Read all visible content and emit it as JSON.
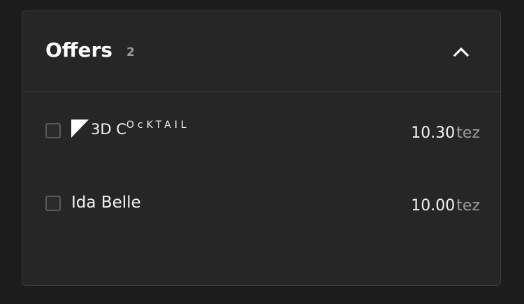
{
  "offers": {
    "title": "Offers",
    "count": "2",
    "items": [
      {
        "name_main": "3D C",
        "name_super": "OcKTAIL",
        "name_full": "3D COcKTAIL",
        "price": "10.30",
        "unit": "tez"
      },
      {
        "name_full": "Ida Belle",
        "price": "10.00",
        "unit": "tez"
      }
    ]
  }
}
